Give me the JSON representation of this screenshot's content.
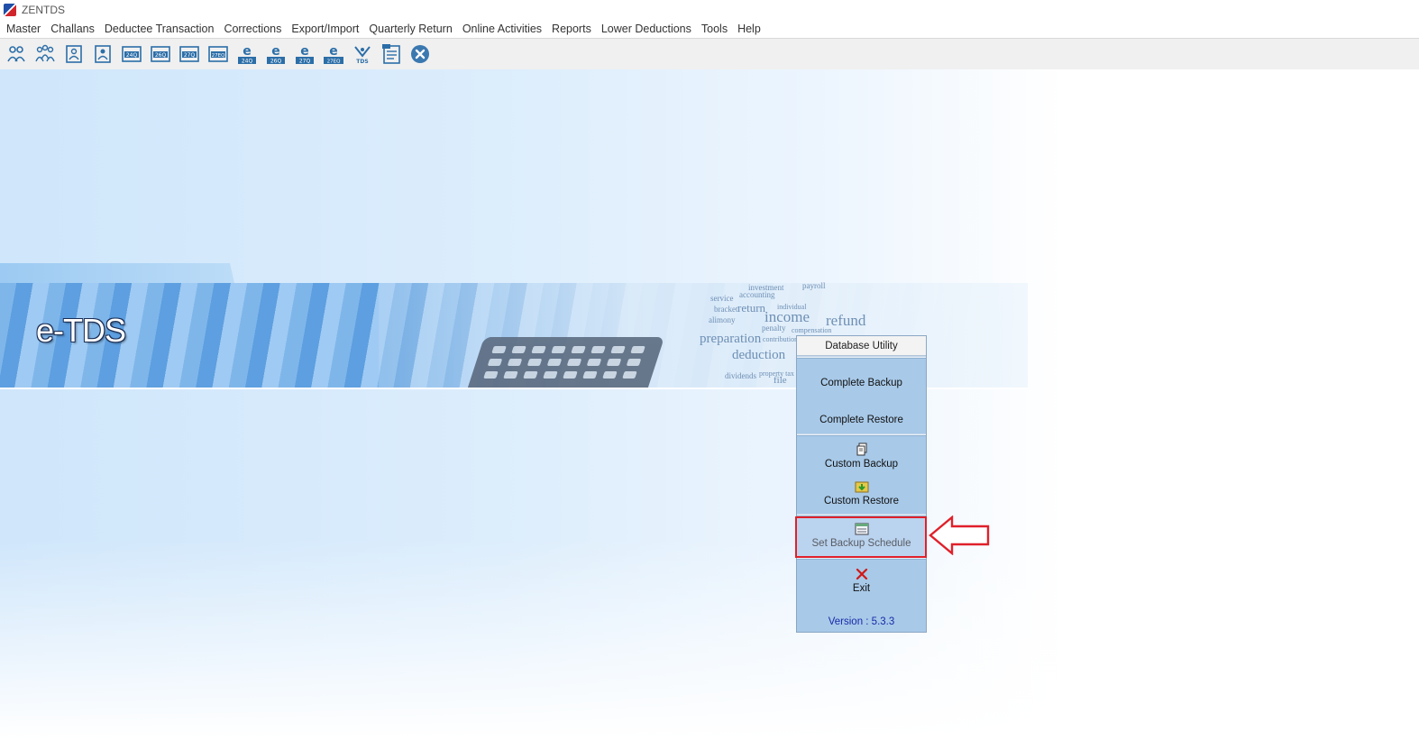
{
  "app": {
    "title": "ZENTDS"
  },
  "menu": [
    "Master",
    "Challans",
    "Deductee Transaction",
    "Corrections",
    "Export/Import",
    "Quarterly Return",
    "Online Activities",
    "Reports",
    "Lower Deductions",
    "Tools",
    "Help"
  ],
  "toolbar": [
    {
      "icon": "deductor-icon"
    },
    {
      "icon": "deductees-icon"
    },
    {
      "icon": "person-form-icon"
    },
    {
      "icon": "person-form-alt-icon"
    },
    {
      "icon": "form-24q-icon",
      "label": "24Q"
    },
    {
      "icon": "form-26q-icon",
      "label": "26Q"
    },
    {
      "icon": "form-27q-icon",
      "label": "27Q"
    },
    {
      "icon": "form-27eq-icon",
      "label": "27EQ"
    },
    {
      "icon": "e-24q-icon",
      "label": "24Q"
    },
    {
      "icon": "e-26q-icon",
      "label": "26Q"
    },
    {
      "icon": "e-27q-icon",
      "label": "27Q"
    },
    {
      "icon": "e-27eq-icon",
      "label": "27EQ"
    },
    {
      "icon": "tds-icon",
      "label": "TDS"
    },
    {
      "icon": "report-icon"
    },
    {
      "icon": "close-icon"
    }
  ],
  "banner": {
    "logo_text": "e-TDS",
    "words": [
      "accounting",
      "investment",
      "payroll",
      "income",
      "refund",
      "penalty",
      "preparation",
      "deduction",
      "dividends",
      "return",
      "compensation",
      "individual",
      "property tax",
      "contribution",
      "alimony",
      "service",
      "bracket",
      "file"
    ]
  },
  "db_utility": {
    "title": "Database Utility",
    "complete_backup": "Complete Backup",
    "complete_restore": "Complete Restore",
    "custom_backup": "Custom Backup",
    "custom_restore": "Custom Restore",
    "set_backup_schedule": "Set Backup Schedule",
    "exit": "Exit",
    "version": "Version : 5.3.3"
  },
  "colors": {
    "highlight": "#e0202a",
    "panel": "#a8c9e8",
    "version_text": "#1a2aa8"
  }
}
